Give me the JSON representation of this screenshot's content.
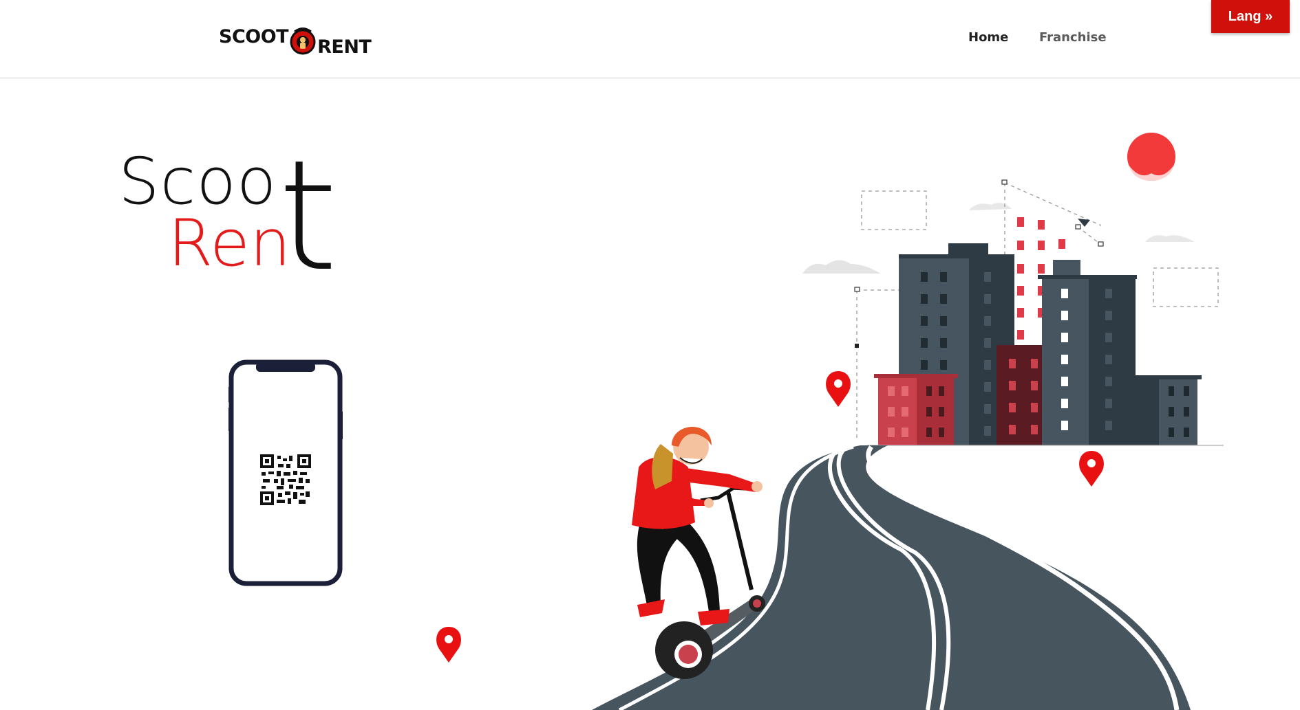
{
  "header": {
    "logo": {
      "word1": "SCOOT",
      "word2": "RENT"
    },
    "nav": [
      {
        "label": "Home"
      },
      {
        "label": "Franchise"
      }
    ],
    "lang_button": "Lang »"
  },
  "hero": {
    "title_line1": "Scoo",
    "title_line2": "Ren",
    "title_big_letter": "t"
  },
  "colors": {
    "accent": "#d0100b",
    "title_red": "#e31b1b",
    "road": "#47555f",
    "building_dark": "#2e3b44",
    "building_mid": "#46555f",
    "building_red": "#c8414d",
    "building_maroon": "#5a1c22",
    "sun": "#f23a3a"
  },
  "icons": [
    "qr-code-icon",
    "location-pin-icon",
    "scooter-rider-illustration",
    "city-buildings-illustration"
  ]
}
